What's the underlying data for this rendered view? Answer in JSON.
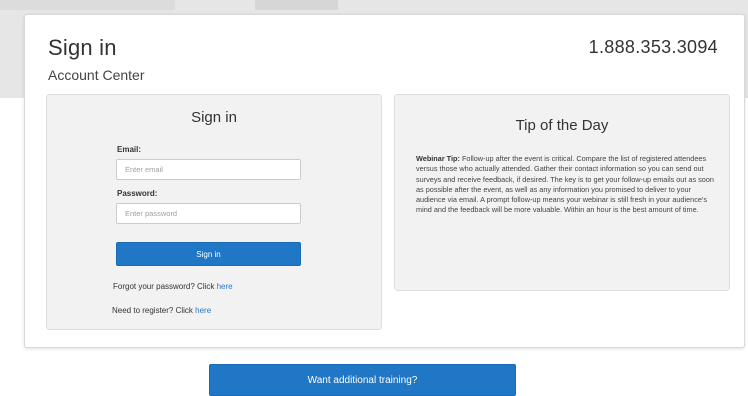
{
  "header": {
    "title": "Sign in",
    "subtitle": "Account Center",
    "phone": "1.888.353.3094"
  },
  "signin": {
    "title": "Sign in",
    "email_label": "Email:",
    "email_placeholder": "Enter email",
    "password_label": "Password:",
    "password_placeholder": "Enter password",
    "button_label": "Sign in",
    "forgot_text": "Forgot your password? Click ",
    "forgot_link": "here",
    "register_text": "Need to register? Click ",
    "register_link": "here"
  },
  "tip": {
    "title": "Tip of the Day",
    "lead": "Webinar Tip:",
    "body": "Follow-up after the event is critical. Compare the list of registered attendees versus those who actually attended. Gather their contact information so you can send out surveys and receive feedback, if desired. The key is to get your follow-up emails out as soon as possible after the event, as well as any information you promised to deliver to your audience via email. A prompt follow-up means your webinar is still fresh in your audience's mind and the feedback will be more valuable. Within an hour is the best amount of time."
  },
  "training_button": "Want additional training?",
  "colors": {
    "accent": "#1f77c6",
    "link": "#2a78c2",
    "panel_bg": "#f2f2f2",
    "band_bg": "#e6e6e6"
  }
}
